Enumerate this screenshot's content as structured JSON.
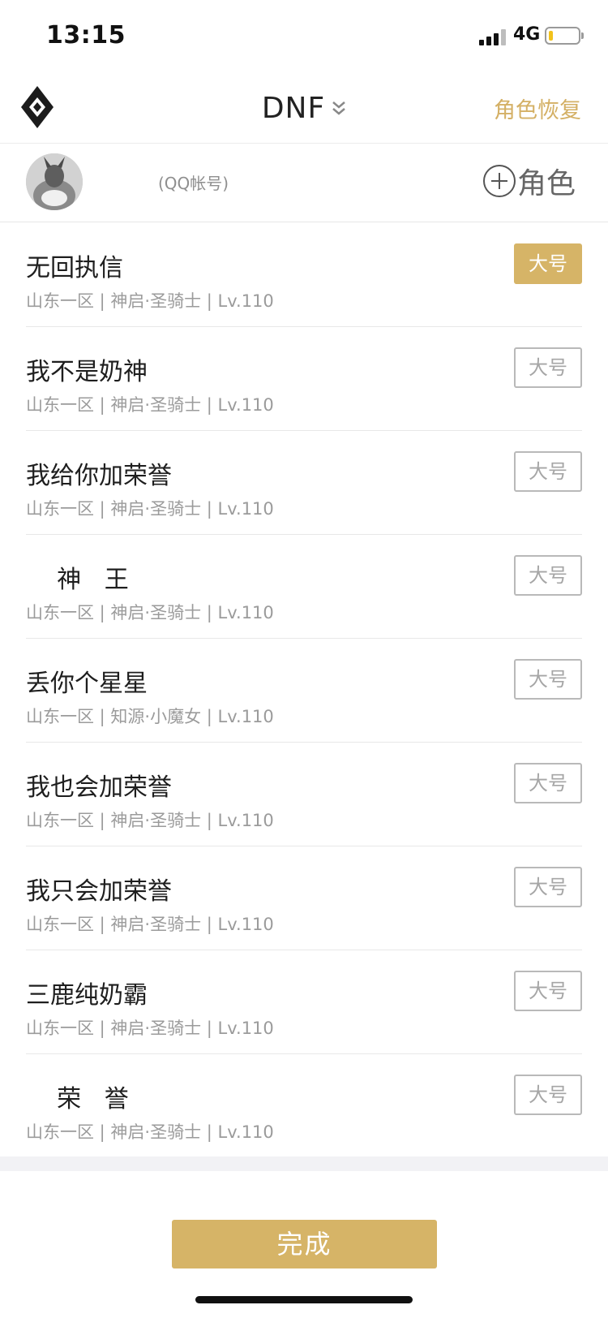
{
  "status_bar": {
    "time": "13:15",
    "network": "4G"
  },
  "nav": {
    "title": "DNF",
    "restore_label": "角色恢复"
  },
  "account": {
    "label": "(QQ帐号)",
    "add_role_label": "角色"
  },
  "roles": [
    {
      "name": "无回执信",
      "meta": "山东一区 | 神启·圣骑士 | Lv.110",
      "main_label": "大号",
      "selected": true
    },
    {
      "name": "我不是奶神",
      "meta": "山东一区 | 神启·圣骑士 | Lv.110",
      "main_label": "大号",
      "selected": false
    },
    {
      "name": "我给你加荣誉",
      "meta": "山东一区 | 神启·圣骑士 | Lv.110",
      "main_label": "大号",
      "selected": false
    },
    {
      "name": "    神   王",
      "meta": "山东一区 | 神启·圣骑士 | Lv.110",
      "main_label": "大号",
      "selected": false
    },
    {
      "name": "丢你个星星",
      "meta": "山东一区 | 知源·小魔女 | Lv.110",
      "main_label": "大号",
      "selected": false
    },
    {
      "name": "我也会加荣誉",
      "meta": "山东一区 | 神启·圣骑士 | Lv.110",
      "main_label": "大号",
      "selected": false
    },
    {
      "name": "我只会加荣誉",
      "meta": "山东一区 | 神启·圣骑士 | Lv.110",
      "main_label": "大号",
      "selected": false
    },
    {
      "name": "三鹿纯奶霸",
      "meta": "山东一区 | 神启·圣骑士 | Lv.110",
      "main_label": "大号",
      "selected": false
    },
    {
      "name": "    荣   誉",
      "meta": "山东一区 | 神启·圣骑士 | Lv.110",
      "main_label": "大号",
      "selected": false
    }
  ],
  "footer": {
    "done_label": "完成"
  },
  "colors": {
    "accent": "#d6b467",
    "restore_text": "#d4b065"
  },
  "icons": {
    "logo": "game-logo-icon",
    "dropdown": "chevron-down-icon",
    "add": "add-circle-icon",
    "signal": "cellular-signal-icon",
    "battery": "battery-icon"
  }
}
